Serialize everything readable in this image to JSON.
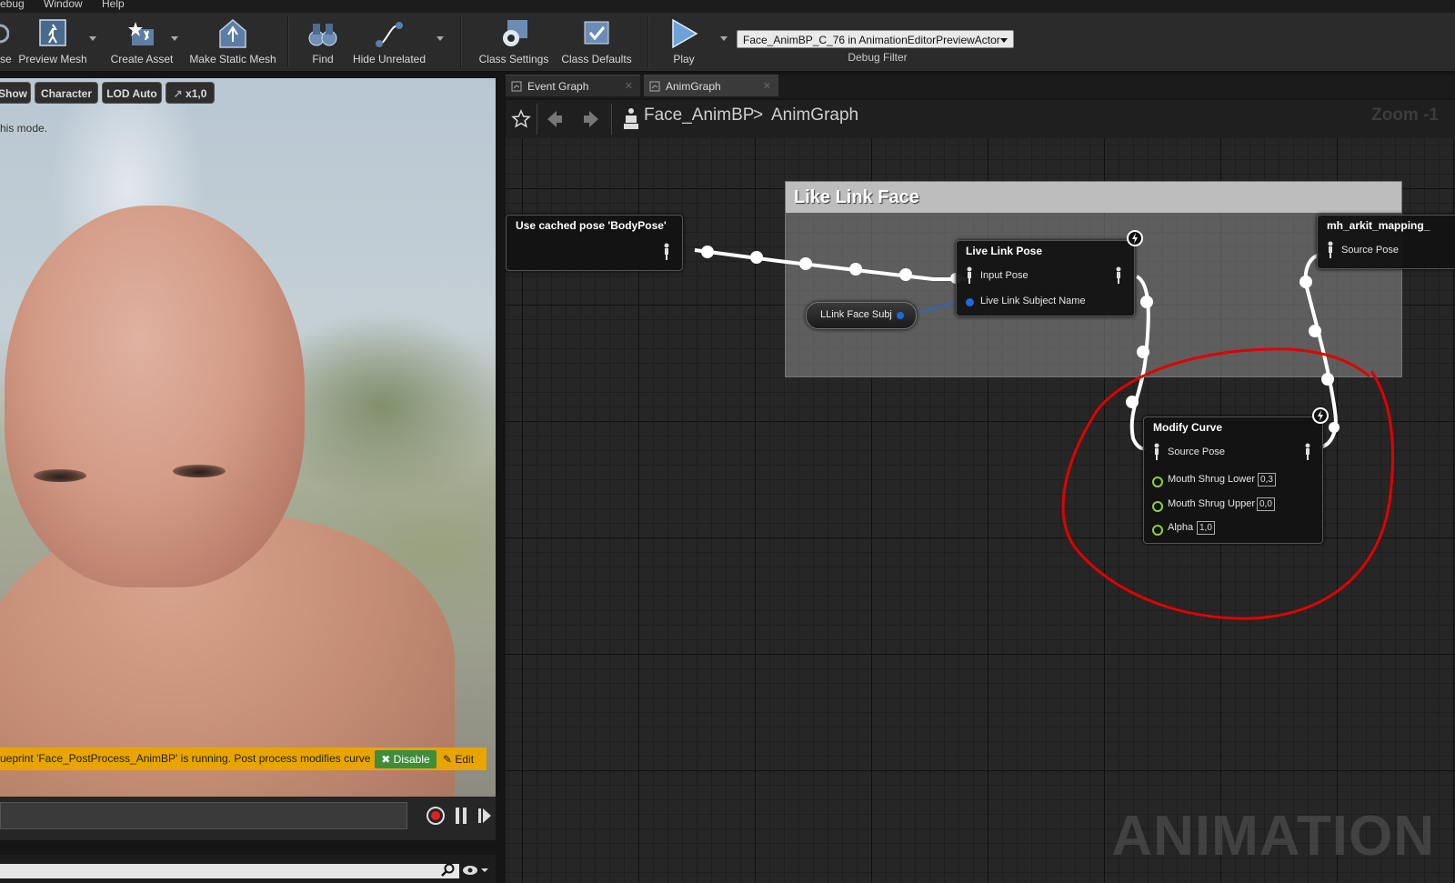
{
  "menu": [
    "ebug",
    "Window",
    "Help"
  ],
  "toolbar": {
    "partial_left": "se",
    "buttons": [
      {
        "label": "Preview Mesh",
        "icon": "preview-mesh-icon"
      },
      {
        "label": "Create Asset",
        "icon": "create-asset-icon"
      },
      {
        "label": "Make Static Mesh",
        "icon": "make-static-mesh-icon"
      },
      {
        "label": "Find",
        "icon": "binoculars-icon"
      },
      {
        "label": "Hide Unrelated",
        "icon": "hide-unrelated-icon"
      },
      {
        "label": "Class Settings",
        "icon": "gear-icon"
      },
      {
        "label": "Class Defaults",
        "icon": "class-defaults-icon"
      },
      {
        "label": "Play",
        "icon": "play-icon"
      }
    ],
    "debug_select_value": "Face_AnimBP_C_76 in AnimationEditorPreviewActor",
    "debug_label": "Debug Filter"
  },
  "viewport": {
    "buttons": [
      "Show",
      "Character",
      "LOD Auto",
      "x1,0"
    ],
    "mode_text": "his mode.",
    "banner_text": "ueprint 'Face_PostProcess_AnimBP' is running. Post process modifies curve",
    "disable_label": "Disable",
    "edit_label": "Edit"
  },
  "graph": {
    "tabs": [
      {
        "label": "Event Graph",
        "active": false
      },
      {
        "label": "AnimGraph",
        "active": true
      }
    ],
    "breadcrumb": {
      "root": "Face_AnimBP",
      "separator": ">",
      "leaf": "AnimGraph"
    },
    "zoom": "Zoom -1",
    "comment": "Like Link Face",
    "nodes": {
      "cached_pose": {
        "title": "Use cached pose 'BodyPose'"
      },
      "live_link_pose": {
        "title": "Live Link Pose",
        "pins": [
          "Input Pose",
          "Live Link Subject Name"
        ]
      },
      "subject_var": {
        "label": "LLink Face Subj"
      },
      "mapping": {
        "title": "mh_arkit_mapping_",
        "pins": [
          "Source Pose"
        ]
      },
      "modify_curve": {
        "title": "Modify Curve",
        "pins": [
          {
            "label": "Source Pose"
          },
          {
            "label": "Mouth Shrug Lower",
            "value": "0,3"
          },
          {
            "label": "Mouth Shrug Upper",
            "value": "0,0"
          },
          {
            "label": "Alpha",
            "value": "1,0"
          }
        ]
      }
    },
    "watermark": "ANIMATION"
  },
  "colors": {
    "annotation": "#e00000",
    "exec_wire": "#ffffff",
    "name_pin": "#1e6ad9",
    "float_pin": "#8bd13a",
    "banner": "#e8a500"
  }
}
